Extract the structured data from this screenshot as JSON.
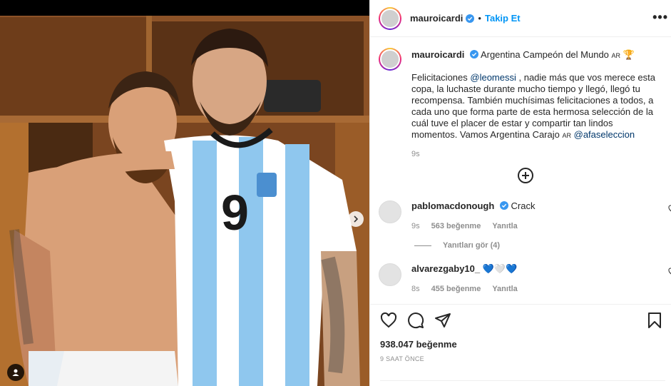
{
  "post": {
    "username": "mauroicardi",
    "follow_label": "Takip Et",
    "more_label": "•••",
    "dot": "•"
  },
  "caption": {
    "username": "mauroicardi",
    "title": "Argentina Campeón del Mundo",
    "flag": "AR",
    "trophy": "🏆",
    "lines": [
      "Felicitaciones ",
      "@leomessi",
      " , nadie más que vos merece esta copa, la luchaste durante mucho tiempo y llegó, llegó tu recompensa. También muchísimas felicitaciones a todos, a cada uno que forma parte de esta hermosa selección de la cuál tuve el placer de estar y compartir tan lindos momentos. Vamos Argentina Carajo ",
      "AR",
      " ",
      "@afaseleccion"
    ],
    "time": "9s"
  },
  "comments": [
    {
      "username": "pablomacdonough",
      "text": "Crack",
      "time": "9s",
      "likes": "563 beğenme",
      "reply": "Yanıtla"
    },
    {
      "username": "alvarezgaby10_",
      "text": "💙🤍💙",
      "time": "8s",
      "likes": "455 beğenme",
      "reply": "Yanıtla"
    }
  ],
  "replies_label": "Yanıtları gör (4)",
  "likes_total": "938.047 beğenme",
  "time_ago": "9 SAAT ÖNCE",
  "colors": {
    "accent": "#0095f6",
    "verified": "#3897f0",
    "mention": "#00376b",
    "muted": "#8e8e8e"
  },
  "icons": {
    "like": "heart-icon",
    "comment": "comment-icon",
    "share": "share-icon",
    "save": "bookmark-icon",
    "load_more": "plus-circle-icon",
    "next": "chevron-right-icon",
    "tag": "user-tag-icon"
  }
}
